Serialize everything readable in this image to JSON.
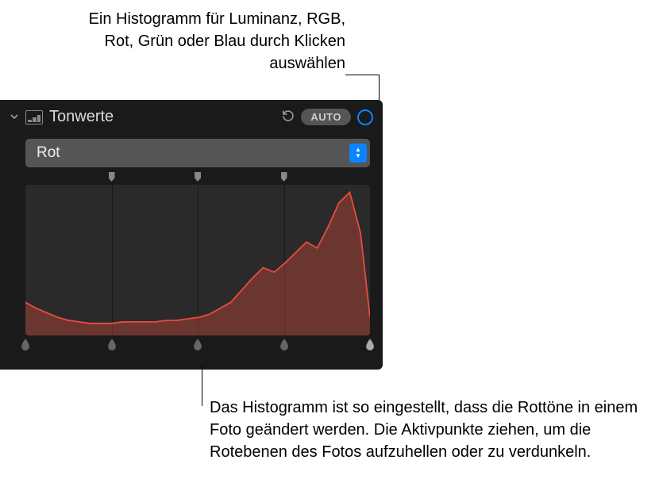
{
  "annotations": {
    "top": "Ein Histogramm für Luminanz, RGB, Rot, Grün oder Blau durch Klicken auswählen",
    "bottom": "Das Histogramm ist so eingestellt, dass die Rottöne in einem Foto geändert werden. Die Aktivpunkte ziehen, um die Rotebenen des Fotos aufzuhellen oder zu verdunkeln."
  },
  "panel": {
    "title": "Tonwerte",
    "auto_label": "AUTO"
  },
  "channel": {
    "selected": "Rot"
  },
  "top_marker_positions": [
    25,
    50,
    75
  ],
  "bottom_marker_positions": [
    0,
    25,
    50,
    75,
    100
  ],
  "chart_data": {
    "type": "area",
    "title": "Rot Histogramm",
    "xlabel": "",
    "ylabel": "",
    "xlim": [
      0,
      255
    ],
    "ylim": [
      0,
      100
    ],
    "color": "#e84c3d",
    "x": [
      0,
      8,
      16,
      24,
      32,
      40,
      48,
      56,
      64,
      72,
      80,
      88,
      96,
      104,
      112,
      120,
      128,
      136,
      144,
      152,
      160,
      168,
      176,
      184,
      192,
      200,
      208,
      216,
      224,
      232,
      240,
      248,
      255
    ],
    "values": [
      22,
      18,
      15,
      12,
      10,
      9,
      8,
      8,
      8,
      9,
      9,
      9,
      9,
      10,
      10,
      11,
      12,
      14,
      18,
      22,
      30,
      38,
      45,
      42,
      48,
      55,
      62,
      58,
      72,
      88,
      95,
      68,
      12
    ]
  }
}
